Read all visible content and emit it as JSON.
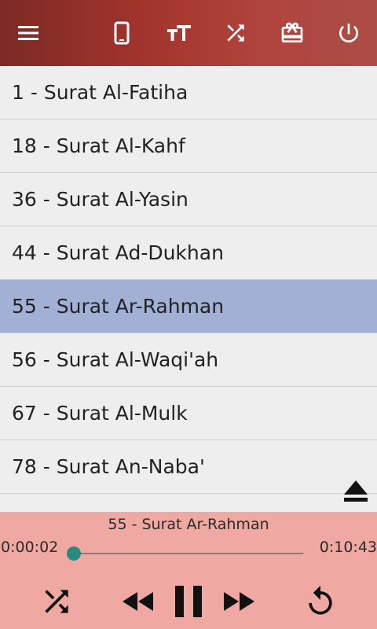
{
  "toolbar": {
    "icons": [
      "menu-icon",
      "phone-icon",
      "text-size-icon",
      "shuffle-icon",
      "gift-card-icon",
      "power-icon"
    ],
    "colors": {
      "start": "#7c2a25",
      "end": "#ad4d47"
    }
  },
  "surahs": [
    {
      "label": "1 - Surat Al-Fatiha",
      "selected": false
    },
    {
      "label": "18 - Surat Al-Kahf",
      "selected": false
    },
    {
      "label": "36 - Surat Al-Yasin",
      "selected": false
    },
    {
      "label": "44 - Surat Ad-Dukhan",
      "selected": false
    },
    {
      "label": "55 - Surat Ar-Rahman",
      "selected": true
    },
    {
      "label": "56 - Surat Al-Waqi'ah",
      "selected": false
    },
    {
      "label": "67 - Surat Al-Mulk",
      "selected": false
    },
    {
      "label": "78 - Surat An-Naba'",
      "selected": false
    }
  ],
  "player": {
    "now_playing": "55 - Surat Ar-Rahman",
    "elapsed": "0:00:02",
    "duration": "0:10:43",
    "progress_fraction": 0.003,
    "controls": [
      "shuffle-icon",
      "rewind-icon",
      "pause-icon",
      "fast-forward-icon",
      "repeat-icon"
    ],
    "background": "#efa8a2",
    "accent": "#2b8a80"
  },
  "selected_color": "#a2b0d6"
}
